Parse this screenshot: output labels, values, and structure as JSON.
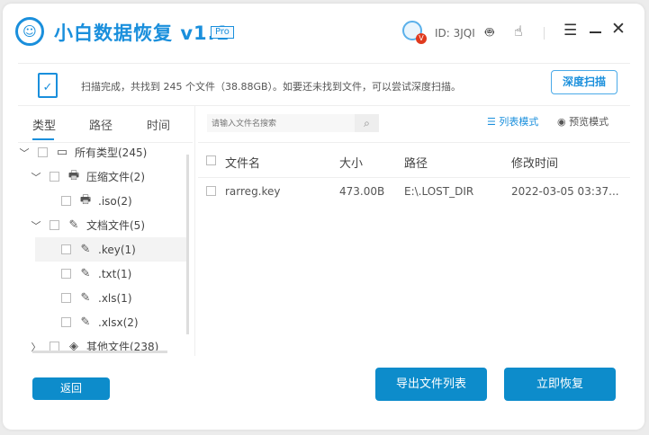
{
  "app": {
    "title": "小白数据恢复",
    "version": "v1.1",
    "badge": "Pro",
    "user_id": "ID: 3JQI",
    "vip_badge": "V"
  },
  "colors": {
    "accent": "#1a8fdc",
    "button": "#0d8ccb"
  },
  "status": {
    "message": "扫描完成，共找到 245 个文件（38.88GB）。如要还未找到文件，可以尝试深度扫描。",
    "deep_scan": "深度扫描"
  },
  "tabs": [
    "类型",
    "路径",
    "时间"
  ],
  "tree": [
    {
      "label": "所有类型(245)",
      "icon": "drive-icon",
      "expanded": true
    },
    {
      "label": "压缩文件(2)",
      "icon": "archive-icon",
      "expanded": true
    },
    {
      "label": ".iso(2)",
      "icon": "archive-icon"
    },
    {
      "label": "文档文件(5)",
      "icon": "document-icon",
      "expanded": true
    },
    {
      "label": ".key(1)",
      "icon": "document-icon",
      "selected": true
    },
    {
      "label": ".txt(1)",
      "icon": "document-icon"
    },
    {
      "label": ".xls(1)",
      "icon": "document-icon"
    },
    {
      "label": ".xlsx(2)",
      "icon": "document-icon"
    },
    {
      "label": "其他文件(238)",
      "icon": "other-icon",
      "expanded": false
    }
  ],
  "search": {
    "placeholder": "请输入文件名搜索"
  },
  "view_modes": {
    "list": "列表模式",
    "preview": "预览模式",
    "active": "list"
  },
  "table": {
    "headers": [
      "文件名",
      "大小",
      "路径",
      "修改时间"
    ],
    "rows": [
      [
        "rarreg.key",
        "473.00B",
        "E:\\.LOST_DIR",
        "2022-03-05 03:37..."
      ]
    ]
  },
  "buttons": {
    "back": "返回",
    "export": "导出文件列表",
    "recover": "立即恢复"
  }
}
